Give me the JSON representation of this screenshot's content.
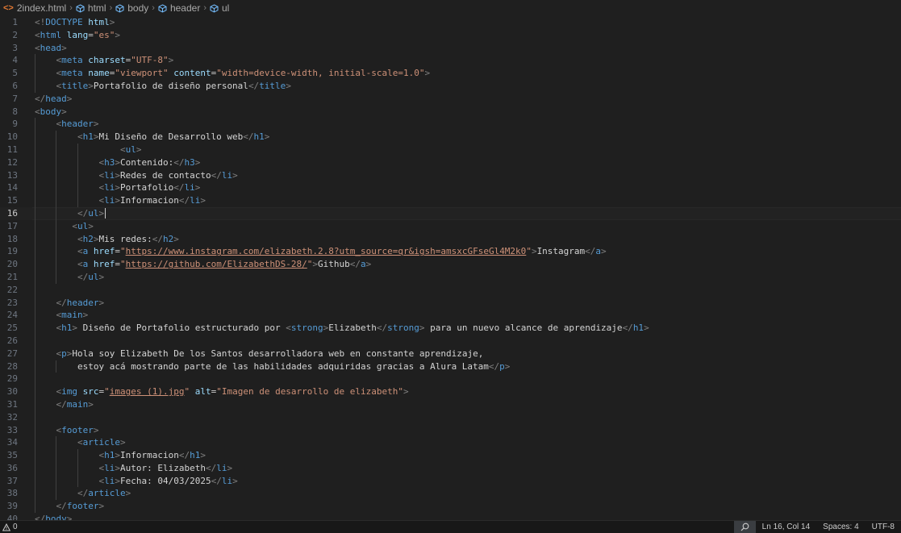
{
  "breadcrumb": [
    "2index.html",
    "html",
    "body",
    "header",
    "ul"
  ],
  "editor": {
    "current_line": 16,
    "lines": [
      {
        "n": "1",
        "indent": 0,
        "html": "<span class=\"tb\">&lt;!</span><span class=\"t\">DOCTYPE</span> <span class=\"a\">html</span><span class=\"tb\">&gt;</span>"
      },
      {
        "n": "2",
        "indent": 0,
        "html": "<span class=\"tb\">&lt;</span><span class=\"t\">html</span> <span class=\"a\">lang</span>=<span class=\"s\">\"es\"</span><span class=\"tb\">&gt;</span>"
      },
      {
        "n": "3",
        "indent": 0,
        "html": "<span class=\"tb\">&lt;</span><span class=\"t\">head</span><span class=\"tb\">&gt;</span>"
      },
      {
        "n": "4",
        "indent": 1,
        "html": "    <span class=\"tb\">&lt;</span><span class=\"t\">meta</span> <span class=\"a\">charset</span>=<span class=\"s\">\"UTF-8\"</span><span class=\"tb\">&gt;</span>"
      },
      {
        "n": "5",
        "indent": 1,
        "html": "    <span class=\"tb\">&lt;</span><span class=\"t\">meta</span> <span class=\"a\">name</span>=<span class=\"s\">\"viewport\"</span> <span class=\"a\">content</span>=<span class=\"s\">\"width=device-width, initial-scale=1.0\"</span><span class=\"tb\">&gt;</span>"
      },
      {
        "n": "6",
        "indent": 1,
        "html": "    <span class=\"tb\">&lt;</span><span class=\"t\">title</span><span class=\"tb\">&gt;</span><span class=\"tx\">Portafolio de diseño personal</span><span class=\"tb\">&lt;/</span><span class=\"t\">title</span><span class=\"tb\">&gt;</span>"
      },
      {
        "n": "7",
        "indent": 0,
        "html": "<span class=\"tb\">&lt;/</span><span class=\"t\">head</span><span class=\"tb\">&gt;</span>"
      },
      {
        "n": "8",
        "indent": 0,
        "html": "<span class=\"tb\">&lt;</span><span class=\"t\">body</span><span class=\"tb\">&gt;</span>"
      },
      {
        "n": "9",
        "indent": 1,
        "html": "    <span class=\"tb\">&lt;</span><span class=\"t\">header</span><span class=\"tb\">&gt;</span>"
      },
      {
        "n": "10",
        "indent": 2,
        "html": "        <span class=\"tb\">&lt;</span><span class=\"t\">h1</span><span class=\"tb\">&gt;</span><span class=\"tx\">Mi Diseño de Desarrollo web</span><span class=\"tb\">&lt;/</span><span class=\"t\">h1</span><span class=\"tb\">&gt;</span>"
      },
      {
        "n": "11",
        "indent": 3,
        "html": "                <span class=\"tb\">&lt;</span><span class=\"t\">ul</span><span class=\"tb\">&gt;</span>"
      },
      {
        "n": "12",
        "indent": 3,
        "html": "            <span class=\"tb\">&lt;</span><span class=\"t\">h3</span><span class=\"tb\">&gt;</span><span class=\"tx\">Contenido:</span><span class=\"tb\">&lt;/</span><span class=\"t\">h3</span><span class=\"tb\">&gt;</span>"
      },
      {
        "n": "13",
        "indent": 3,
        "html": "            <span class=\"tb\">&lt;</span><span class=\"t\">li</span><span class=\"tb\">&gt;</span><span class=\"tx\">Redes de contacto</span><span class=\"tb\">&lt;/</span><span class=\"t\">li</span><span class=\"tb\">&gt;</span>"
      },
      {
        "n": "14",
        "indent": 3,
        "html": "            <span class=\"tb\">&lt;</span><span class=\"t\">li</span><span class=\"tb\">&gt;</span><span class=\"tx\">Portafolio</span><span class=\"tb\">&lt;/</span><span class=\"t\">li</span><span class=\"tb\">&gt;</span>"
      },
      {
        "n": "15",
        "indent": 3,
        "html": "            <span class=\"tb\">&lt;</span><span class=\"t\">li</span><span class=\"tb\">&gt;</span><span class=\"tx\">Informacion</span><span class=\"tb\">&lt;/</span><span class=\"t\">li</span><span class=\"tb\">&gt;</span>"
      },
      {
        "n": "16",
        "indent": 2,
        "html": "        <span class=\"tb\">&lt;/</span><span class=\"t\">ul</span><span class=\"tb\">&gt;</span><span class=\"cursor\"></span>"
      },
      {
        "n": "17",
        "indent": 2,
        "html": "       <span class=\"tb\">&lt;</span><span class=\"t\">ul</span><span class=\"tb\">&gt;</span>"
      },
      {
        "n": "18",
        "indent": 2,
        "html": "        <span class=\"tb\">&lt;</span><span class=\"t\">h2</span><span class=\"tb\">&gt;</span><span class=\"tx\">Mis redes:</span><span class=\"tb\">&lt;/</span><span class=\"t\">h2</span><span class=\"tb\">&gt;</span>"
      },
      {
        "n": "19",
        "indent": 2,
        "html": "        <span class=\"tb\">&lt;</span><span class=\"t\">a</span> <span class=\"a\">href</span>=<span class=\"s\">\"<span class=\"u\">https://www.instagram.com/elizabeth.2.8?utm_source=qr&amp;igsh=amsxcGFseGl4M2k0</span>\"</span><span class=\"tb\">&gt;</span><span class=\"tx\">Instagram</span><span class=\"tb\">&lt;/</span><span class=\"t\">a</span><span class=\"tb\">&gt;</span>"
      },
      {
        "n": "20",
        "indent": 2,
        "html": "        <span class=\"tb\">&lt;</span><span class=\"t\">a</span> <span class=\"a\">href</span>=<span class=\"s\">\"<span class=\"u\">https://github.com/ElizabethDS-28/</span>\"</span><span class=\"tb\">&gt;</span><span class=\"tx\">Github</span><span class=\"tb\">&lt;/</span><span class=\"t\">a</span><span class=\"tb\">&gt;</span>"
      },
      {
        "n": "21",
        "indent": 2,
        "html": "        <span class=\"tb\">&lt;/</span><span class=\"t\">ul</span><span class=\"tb\">&gt;</span>"
      },
      {
        "n": "22",
        "indent": 1,
        "html": ""
      },
      {
        "n": "23",
        "indent": 1,
        "html": "    <span class=\"tb\">&lt;/</span><span class=\"t\">header</span><span class=\"tb\">&gt;</span>"
      },
      {
        "n": "24",
        "indent": 1,
        "html": "    <span class=\"tb\">&lt;</span><span class=\"t\">main</span><span class=\"tb\">&gt;</span>"
      },
      {
        "n": "25",
        "indent": 1,
        "html": "    <span class=\"tb\">&lt;</span><span class=\"t\">h1</span><span class=\"tb\">&gt;</span><span class=\"tx\"> Diseño de Portafolio estructurado por </span><span class=\"tb\">&lt;</span><span class=\"t\">strong</span><span class=\"tb\">&gt;</span><span class=\"tx\">Elizabeth</span><span class=\"tb\">&lt;/</span><span class=\"t\">strong</span><span class=\"tb\">&gt;</span><span class=\"tx\"> para un nuevo alcance de aprendizaje</span><span class=\"tb\">&lt;/</span><span class=\"t\">h1</span><span class=\"tb\">&gt;</span>"
      },
      {
        "n": "26",
        "indent": 1,
        "html": ""
      },
      {
        "n": "27",
        "indent": 1,
        "html": "    <span class=\"tb\">&lt;</span><span class=\"t\">p</span><span class=\"tb\">&gt;</span><span class=\"tx\">Hola soy Elizabeth De los Santos desarrolladora web en constante aprendizaje,</span>"
      },
      {
        "n": "28",
        "indent": 2,
        "html": "        <span class=\"tx\">estoy acá mostrando parte de las habilidades adquiridas gracias a Alura Latam</span><span class=\"tb\">&lt;/</span><span class=\"t\">p</span><span class=\"tb\">&gt;</span>"
      },
      {
        "n": "29",
        "indent": 1,
        "html": ""
      },
      {
        "n": "30",
        "indent": 1,
        "html": "    <span class=\"tb\">&lt;</span><span class=\"t\">img</span> <span class=\"a\">src</span>=<span class=\"s\">\"<span class=\"u\">images (1).jpg</span>\"</span> <span class=\"a\">alt</span>=<span class=\"s\">\"Imagen de desarrollo de elizabeth\"</span><span class=\"tb\">&gt;</span>"
      },
      {
        "n": "31",
        "indent": 1,
        "html": "    <span class=\"tb\">&lt;/</span><span class=\"t\">main</span><span class=\"tb\">&gt;</span>"
      },
      {
        "n": "32",
        "indent": 1,
        "html": ""
      },
      {
        "n": "33",
        "indent": 1,
        "html": "    <span class=\"tb\">&lt;</span><span class=\"t\">footer</span><span class=\"tb\">&gt;</span>"
      },
      {
        "n": "34",
        "indent": 2,
        "html": "        <span class=\"tb\">&lt;</span><span class=\"t\">article</span><span class=\"tb\">&gt;</span>"
      },
      {
        "n": "35",
        "indent": 3,
        "html": "            <span class=\"tb\">&lt;</span><span class=\"t\">h1</span><span class=\"tb\">&gt;</span><span class=\"tx\">Informacion</span><span class=\"tb\">&lt;/</span><span class=\"t\">h1</span><span class=\"tb\">&gt;</span>"
      },
      {
        "n": "36",
        "indent": 3,
        "html": "            <span class=\"tb\">&lt;</span><span class=\"t\">li</span><span class=\"tb\">&gt;</span><span class=\"tx\">Autor: Elizabeth</span><span class=\"tb\">&lt;/</span><span class=\"t\">li</span><span class=\"tb\">&gt;</span>"
      },
      {
        "n": "37",
        "indent": 3,
        "html": "            <span class=\"tb\">&lt;</span><span class=\"t\">li</span><span class=\"tb\">&gt;</span><span class=\"tx\">Fecha: 04/03/2025</span><span class=\"tb\">&lt;/</span><span class=\"t\">li</span><span class=\"tb\">&gt;</span>"
      },
      {
        "n": "38",
        "indent": 2,
        "html": "        <span class=\"tb\">&lt;/</span><span class=\"t\">article</span><span class=\"tb\">&gt;</span>"
      },
      {
        "n": "39",
        "indent": 1,
        "html": "    <span class=\"tb\">&lt;/</span><span class=\"t\">footer</span><span class=\"tb\">&gt;</span>"
      },
      {
        "n": "40",
        "indent": 0,
        "html": "<span class=\"tb\">&lt;/</span><span class=\"t\">body</span><span class=\"tb\">&gt;</span>"
      }
    ]
  },
  "statusbar": {
    "problems": "0",
    "position": "Ln 16, Col 14",
    "spaces": "Spaces: 4",
    "encoding": "UTF-8"
  }
}
